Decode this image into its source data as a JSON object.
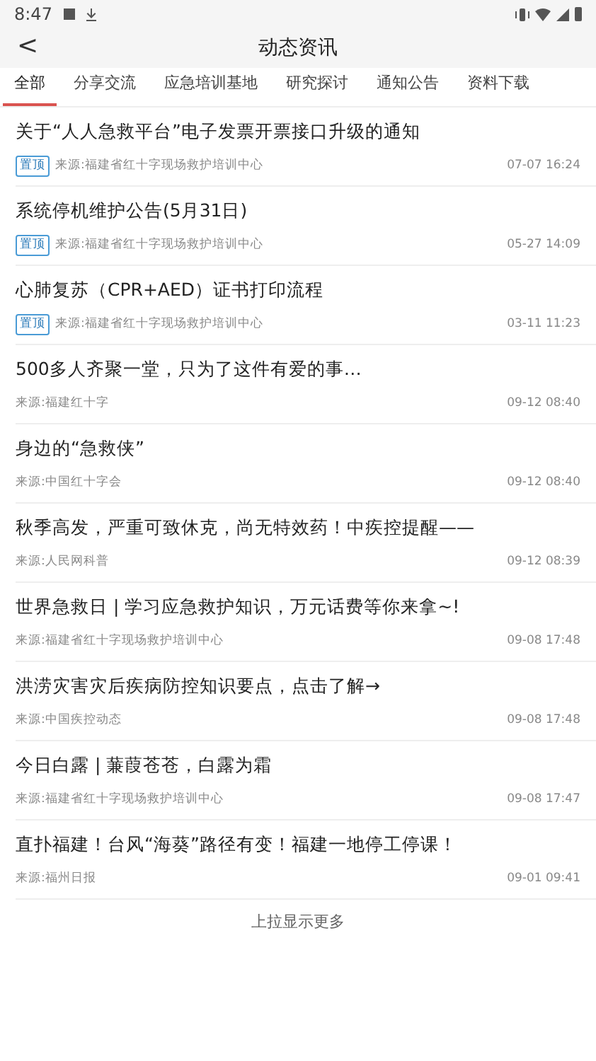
{
  "status_bar": {
    "time": "8:47"
  },
  "header": {
    "back": "<",
    "title": "动态资讯"
  },
  "tabs": [
    {
      "label": "全部",
      "selected": true
    },
    {
      "label": "分享交流",
      "selected": false
    },
    {
      "label": "应急培训基地",
      "selected": false
    },
    {
      "label": "研究探讨",
      "selected": false
    },
    {
      "label": "通知公告",
      "selected": false
    },
    {
      "label": "资料下载",
      "selected": false
    }
  ],
  "news": [
    {
      "title": "关于“人人急救平台”电子发票开票接口升级的通知",
      "badge": "置顶",
      "source": "来源:福建省红十字现场救护培训中心",
      "time": "07-07 16:24"
    },
    {
      "title": "系统停机维护公告(5月31日)",
      "badge": "置顶",
      "source": "来源:福建省红十字现场救护培训中心",
      "time": "05-27 14:09"
    },
    {
      "title": "心肺复苏（CPR+AED）证书打印流程",
      "badge": "置顶",
      "source": "来源:福建省红十字现场救护培训中心",
      "time": "03-11 11:23"
    },
    {
      "title": "500多人齐聚一堂，只为了这件有爱的事…",
      "source": "来源:福建红十字",
      "time": "09-12 08:40"
    },
    {
      "title": "身边的“急救侠”",
      "source": "来源:中国红十字会",
      "time": "09-12 08:40"
    },
    {
      "title": "秋季高发，严重可致休克，尚无特效药！中疾控提醒——",
      "source": "来源:人民网科普",
      "time": "09-12 08:39"
    },
    {
      "title": "世界急救日 | 学习应急救护知识，万元话费等你来拿~!",
      "source": "来源:福建省红十字现场救护培训中心",
      "time": "09-08 17:48"
    },
    {
      "title": "洪涝灾害灾后疾病防控知识要点，点击了解→",
      "source": "来源:中国疾控动态",
      "time": "09-08 17:48"
    },
    {
      "title": "今日白露 | 蒹葭苍苍，白露为霜",
      "source": "来源:福建省红十字现场救护培训中心",
      "time": "09-08 17:47"
    },
    {
      "title": "直扑福建！台风“海葵”路径有变！福建一地停工停课！",
      "source": "来源:福州日报",
      "time": "09-01 09:41"
    }
  ],
  "footer": "上拉显示更多"
}
